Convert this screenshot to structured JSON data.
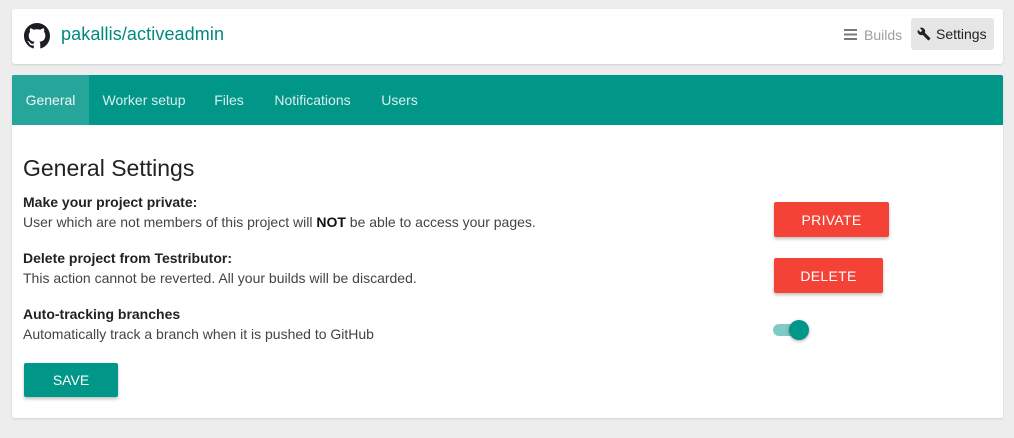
{
  "header": {
    "project_name": "pakallis/activeadmin",
    "logo_icon": "github-icon",
    "nav": {
      "builds_label": "Builds",
      "builds_icon": "list-icon",
      "settings_label": "Settings",
      "settings_icon": "wrench-icon"
    }
  },
  "tabs": [
    {
      "label": "General",
      "active": true
    },
    {
      "label": "Worker setup",
      "active": false
    },
    {
      "label": "Files",
      "active": false
    },
    {
      "label": "Notifications",
      "active": false
    },
    {
      "label": "Users",
      "active": false
    }
  ],
  "general": {
    "title": "General Settings",
    "private": {
      "title": "Make your project private:",
      "desc_before": "User which are not members of this project will ",
      "desc_bold": "NOT",
      "desc_after": " be able to access your pages.",
      "button_label": "PRIVATE"
    },
    "delete": {
      "title": "Delete project from Testributor:",
      "desc": "This action cannot be reverted. All your builds will be discarded.",
      "button_label": "DELETE"
    },
    "auto_tracking": {
      "title": "Auto-tracking branches",
      "desc": "Automatically track a branch when it is pushed to GitHub",
      "enabled": true
    },
    "save_label": "SAVE"
  },
  "colors": {
    "primary": "#009688",
    "primary_light": "#26a69a",
    "danger": "#f44336",
    "link": "#00897b"
  }
}
